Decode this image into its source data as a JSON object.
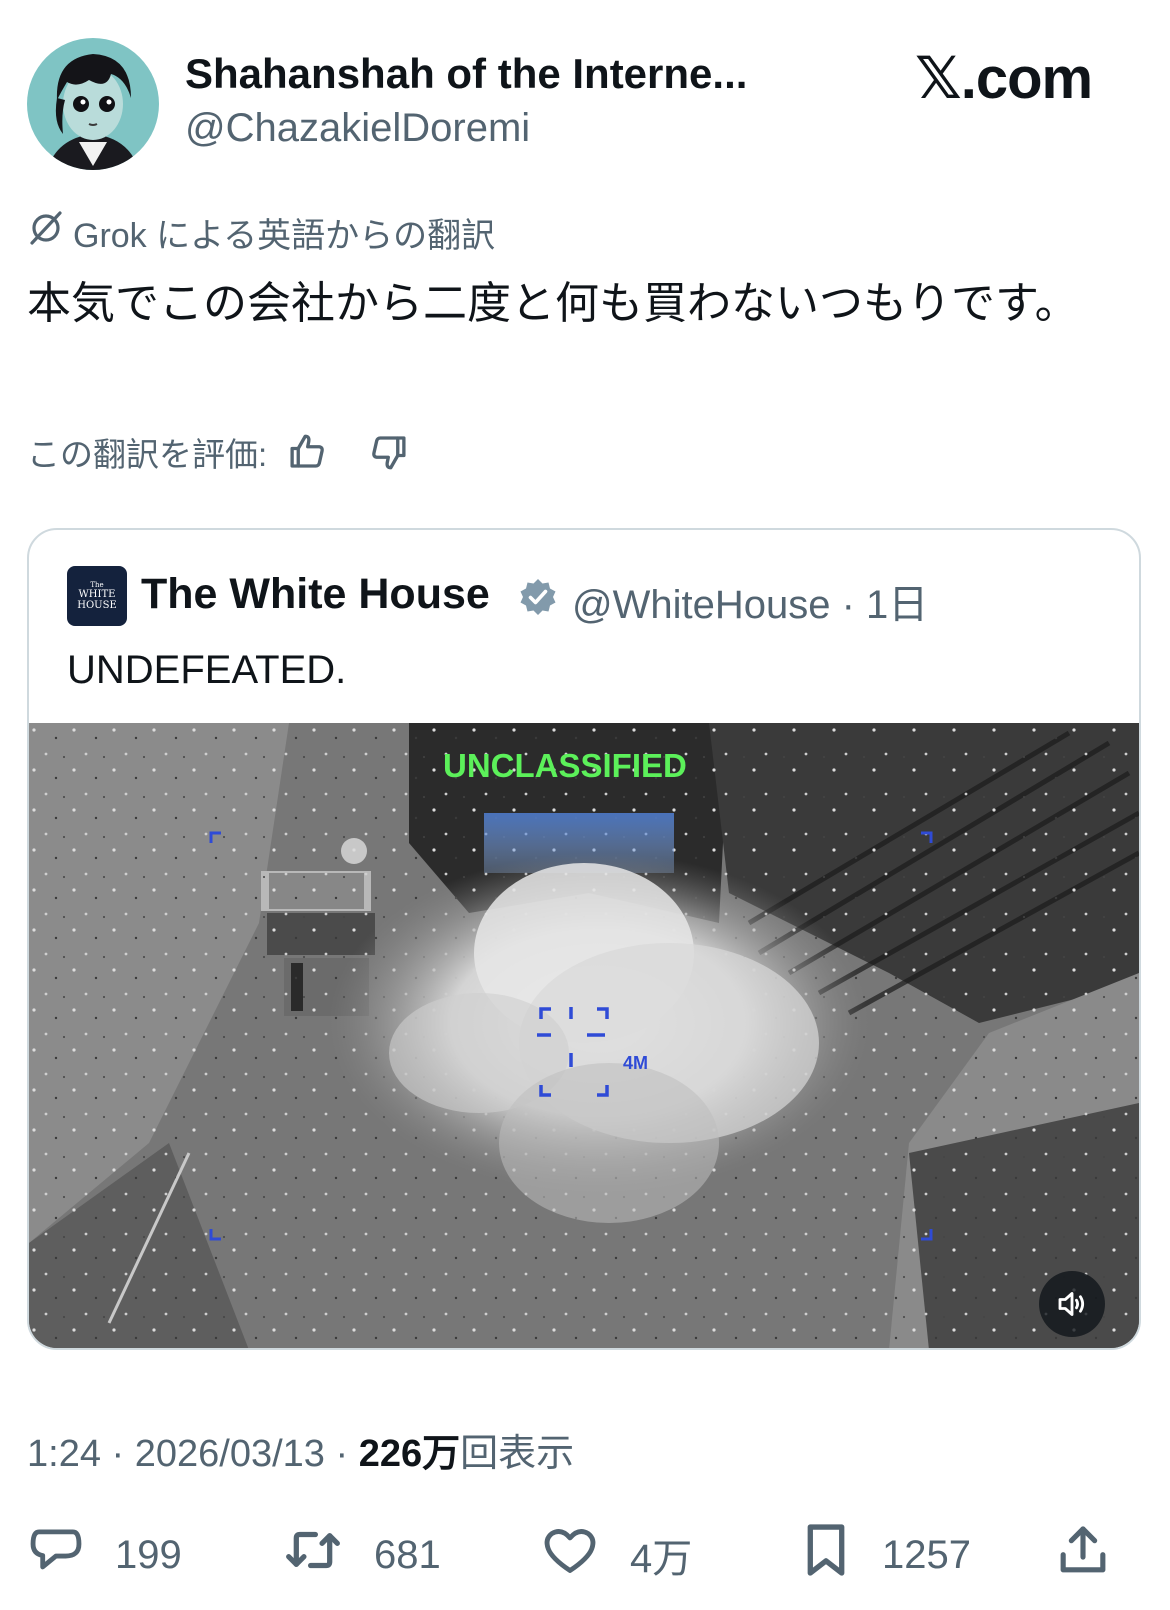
{
  "author": {
    "display_name": "Shahanshah of the Interne...",
    "handle": "@ChazakielDoremi",
    "avatar_icon": "anime-avatar"
  },
  "brand": {
    "x_symbol": "𝕏",
    "suffix": ".com"
  },
  "translation": {
    "label": "Grok による英語からの翻訳",
    "text": "本気でこの会社から二度と何も買わないつもりです。",
    "rate_label": "この翻訳を評価:"
  },
  "quoted_post": {
    "author_name": "The White House",
    "handle_time": "@WhiteHouse · 1日",
    "text": "UNDEFEATED.",
    "avatar_text_1": "The",
    "avatar_text_2": "WHITE",
    "avatar_text_3": "HOUSE",
    "media": {
      "overlay_text": "UNCLASSIFIED",
      "hud_label": "4M"
    }
  },
  "meta": {
    "time_date": "1:24 · 2026/03/13 · ",
    "views_count": "226万",
    "views_label": "回表示"
  },
  "actions": {
    "replies": "199",
    "reposts": "681",
    "likes": "4万",
    "bookmarks": "1257"
  },
  "colors": {
    "text_primary": "#0f1419",
    "text_secondary": "#536471",
    "border": "#cfd9de",
    "verified_badge": "#829aab",
    "overlay_green": "#5cf05a",
    "hud_blue": "#2f4bd6"
  }
}
